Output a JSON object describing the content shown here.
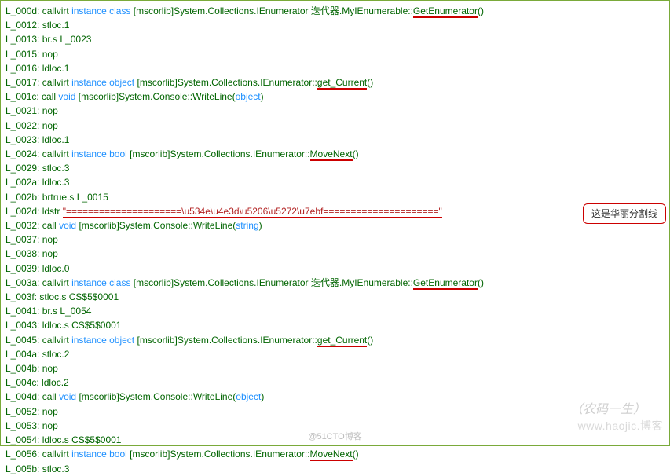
{
  "callout_text": "这是华丽分割线",
  "watermark_top": "（农码一生）",
  "watermark_mid": "www.haojic.博客",
  "watermark_bottom": "@51CTO博客",
  "lines": [
    {
      "addr": "L_000d:",
      "op": "callvirt",
      "kw": "instance class",
      "p1": "[mscorlib]System.Collections.IEnumerator 迭代器.MyIEnumerable::",
      "u": "GetEnumerator",
      "p2": "()",
      "ul": true
    },
    {
      "addr": "L_0012:",
      "op": "stloc.1"
    },
    {
      "addr": "L_0013:",
      "op": "br.s",
      "arg": "L_0023"
    },
    {
      "addr": "L_0015:",
      "op": "nop"
    },
    {
      "addr": "L_0016:",
      "op": "ldloc.1"
    },
    {
      "addr": "L_0017:",
      "op": "callvirt",
      "kw": "instance object",
      "p1": "[mscorlib]System.Collections.IEnumerator::",
      "u": "get_Current",
      "p2": "()",
      "ul": true
    },
    {
      "addr": "L_001c:",
      "op": "call",
      "kw": "void",
      "p1": "[mscorlib]System.Console::WriteLine(",
      "u": "",
      "p2": "",
      "kw2": "object",
      "p3": ")"
    },
    {
      "addr": "L_0021:",
      "op": "nop"
    },
    {
      "addr": "L_0022:",
      "op": "nop"
    },
    {
      "addr": "L_0023:",
      "op": "ldloc.1"
    },
    {
      "addr": "L_0024:",
      "op": "callvirt",
      "kw": "instance bool",
      "p1": "[mscorlib]System.Collections.IEnumerator::",
      "u": "MoveNext",
      "p2": "()",
      "ul": true
    },
    {
      "addr": "L_0029:",
      "op": "stloc.3"
    },
    {
      "addr": "L_002a:",
      "op": "ldloc.3"
    },
    {
      "addr": "L_002b:",
      "op": "brtrue.s",
      "arg": "L_0015"
    },
    {
      "addr": "L_002d:",
      "op": "ldstr",
      "str": "\"=====================\\u534e\\u4e3d\\u5206\\u5272\\u7ebf=====================\"",
      "strul": true
    },
    {
      "addr": "L_0032:",
      "op": "call",
      "kw": "void",
      "p1": "[mscorlib]System.Console::WriteLine(",
      "u": "",
      "p2": "",
      "kw2": "string",
      "p3": ")"
    },
    {
      "addr": "L_0037:",
      "op": "nop"
    },
    {
      "addr": "L_0038:",
      "op": "nop"
    },
    {
      "addr": "L_0039:",
      "op": "ldloc.0"
    },
    {
      "addr": "L_003a:",
      "op": "callvirt",
      "kw": "instance class",
      "p1": "[mscorlib]System.Collections.IEnumerator 迭代器.MyIEnumerable::",
      "u": "GetEnumerator",
      "p2": "()",
      "ul": true
    },
    {
      "addr": "L_003f:",
      "op": "stloc.s",
      "arg": "CS$5$0001"
    },
    {
      "addr": "L_0041:",
      "op": "br.s",
      "arg": "L_0054"
    },
    {
      "addr": "L_0043:",
      "op": "ldloc.s",
      "arg": "CS$5$0001"
    },
    {
      "addr": "L_0045:",
      "op": "callvirt",
      "kw": "instance object",
      "p1": "[mscorlib]System.Collections.IEnumerator::",
      "u": "get_Current",
      "p2": "()",
      "ul": true
    },
    {
      "addr": "L_004a:",
      "op": "stloc.2"
    },
    {
      "addr": "L_004b:",
      "op": "nop"
    },
    {
      "addr": "L_004c:",
      "op": "ldloc.2"
    },
    {
      "addr": "L_004d:",
      "op": "call",
      "kw": "void",
      "p1": "[mscorlib]System.Console::WriteLine(",
      "u": "",
      "p2": "",
      "kw2": "object",
      "p3": ")"
    },
    {
      "addr": "L_0052:",
      "op": "nop"
    },
    {
      "addr": "L_0053:",
      "op": "nop"
    },
    {
      "addr": "L_0054:",
      "op": "ldloc.s",
      "arg": "CS$5$0001"
    },
    {
      "addr": "L_0056:",
      "op": "callvirt",
      "kw": "instance bool",
      "p1": "[mscorlib]System.Collections.IEnumerator::",
      "u": "MoveNext",
      "p2": "()",
      "ul": true
    },
    {
      "addr": "L_005b:",
      "op": "stloc.3"
    }
  ]
}
